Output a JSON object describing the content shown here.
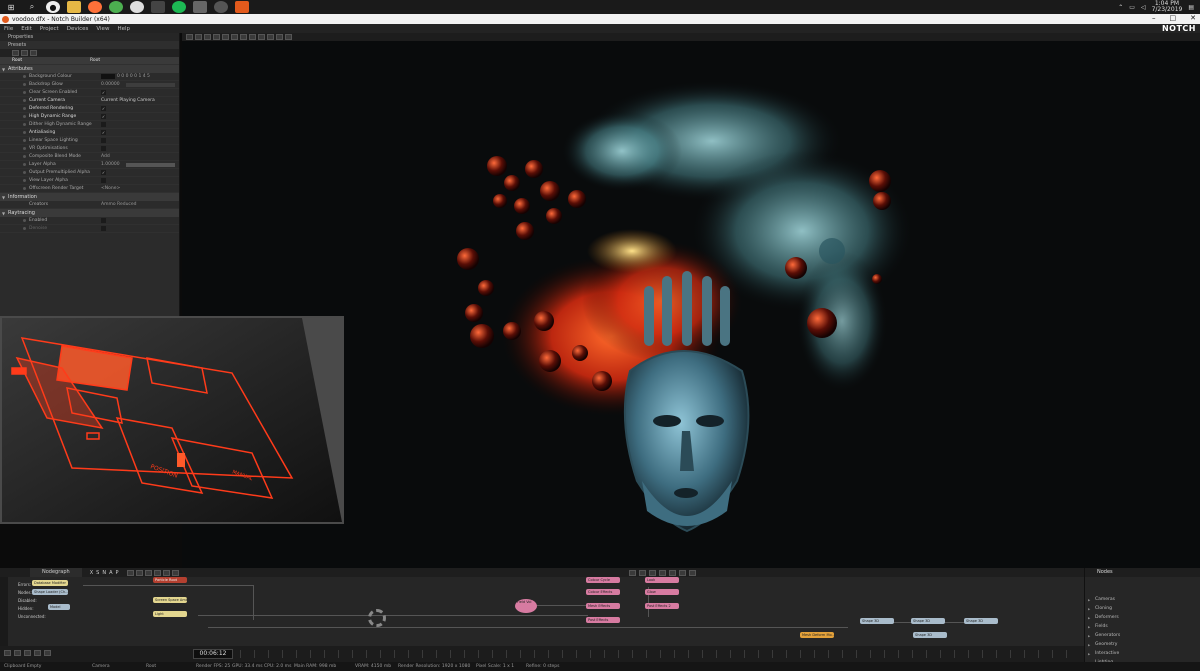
{
  "taskbar": {
    "icons": [
      "windows-icon",
      "search-icon",
      "cortana-icon",
      "explorer-icon",
      "firefox-icon",
      "chrome-icon",
      "obs-icon",
      "monitor-icon",
      "spotify-icon",
      "photos-icon",
      "steam-icon",
      "notch-icon"
    ],
    "clock_time": "1:04 PM",
    "clock_date": "7/23/2019"
  },
  "window": {
    "title": "voodoo.dfx - Notch Builder (x64)",
    "brand": "NOTCH"
  },
  "menu": [
    "File",
    "Edit",
    "Project",
    "Devices",
    "View",
    "Help"
  ],
  "properties": {
    "panel_title": "Properties",
    "presets_label": "Presets",
    "root_label": "Root",
    "root_value": "Root",
    "attributes_section": "Attributes",
    "rows": [
      {
        "label": "Background Colour",
        "value": "0 0 0 0 0 1 4 5"
      },
      {
        "label": "Backdrop Glow",
        "value": "0.00000"
      },
      {
        "label": "Clear Screen Enabled",
        "check": "✓"
      },
      {
        "label": "Current Camera",
        "value": "Current Playing Camera"
      },
      {
        "label": "Deferred Rendering",
        "check": "✓"
      },
      {
        "label": "High Dynamic Range",
        "check": "✓"
      },
      {
        "label": "Dither High Dynamic Range",
        "check": ""
      },
      {
        "label": "Antialiasing",
        "check": "✓"
      },
      {
        "label": "Linear Space Lighting",
        "check": ""
      },
      {
        "label": "VR Optimisations",
        "check": ""
      },
      {
        "label": "Composite Blend Mode",
        "value": "Add"
      },
      {
        "label": "Layer Alpha",
        "value": "1.00000"
      },
      {
        "label": "Output Premultiplied Alpha",
        "check": "✓"
      },
      {
        "label": "View Layer Alpha",
        "check": ""
      },
      {
        "label": "Offscreen Render Target",
        "value": "<None>"
      }
    ],
    "information_section": "Information",
    "info_rows": [
      {
        "label": "Creators",
        "value": "Ammo Reduced"
      }
    ],
    "raytracing_section": "Raytracing",
    "ray_rows": [
      {
        "label": "Enabled",
        "check": ""
      },
      {
        "label": "Denoise",
        "check": ""
      }
    ]
  },
  "inset_overlay": {
    "labels": [
      "POSITION",
      "MANUAL"
    ]
  },
  "nodegraph": {
    "tab_label": "Nodegraph",
    "toolbar_letters": [
      "X",
      "S",
      "N",
      "A",
      "P"
    ],
    "legend": [
      "Errors:",
      "Nodes:",
      "Disabled:",
      "Hidden:",
      "Unconnected:"
    ],
    "nodes": [
      {
        "label": "Database Modifier",
        "color": "n-y"
      },
      {
        "label": "Shape Loader (Ch...",
        "color": "n-b"
      },
      {
        "label": "Model",
        "color": "n-b"
      },
      {
        "label": "Screen Space Amb...",
        "color": "n-y"
      },
      {
        "label": "Light",
        "color": "n-y"
      },
      {
        "label": "Particle Root",
        "color": "n-r"
      },
      {
        "label": "Field Vol",
        "color": "n-p"
      },
      {
        "label": "Colour Cycle",
        "color": "n-p"
      },
      {
        "label": "Colour Effects",
        "color": "n-p"
      },
      {
        "label": "Mesh Effects",
        "color": "n-p"
      },
      {
        "label": "Post Effects",
        "color": "n-p"
      },
      {
        "label": "Look",
        "color": "n-p"
      },
      {
        "label": "Glow",
        "color": "n-p"
      },
      {
        "label": "Post Effects 2",
        "color": "n-p"
      },
      {
        "label": "Shape 3D",
        "color": "n-b"
      },
      {
        "label": "Shape 3D",
        "color": "n-b"
      },
      {
        "label": "Shape 3D",
        "color": "n-b"
      },
      {
        "label": "Shape 3D",
        "color": "n-b"
      },
      {
        "label": "Mesh Deform Mo...",
        "color": "n-o"
      }
    ]
  },
  "nodes_panel": {
    "title": "Nodes",
    "items": [
      "Cameras",
      "Cloning",
      "Deformers",
      "Fields",
      "Generators",
      "Geometry",
      "Interactive",
      "Lighting"
    ]
  },
  "timeline": {
    "timecode": "00:06:12"
  },
  "status": {
    "items": [
      "Clipboard Empty",
      "Camera",
      "Root",
      "Render FPS: 25",
      "GPU: 33.4 ms",
      "CPU: 2.0 ms",
      "Main RAM: 998 mb",
      "VRAM: 4150 mb",
      "Render Resolution: 1920 x 1080",
      "Pixel Scale: 1 x 1",
      "Refine: 0 steps"
    ]
  },
  "colors": {
    "accent": "#e25a1c",
    "inset_glow": "#ff3b1a",
    "smoke": "#7fb7bf",
    "mask": "#6fa3b5",
    "fire": "#ff4a1a"
  }
}
